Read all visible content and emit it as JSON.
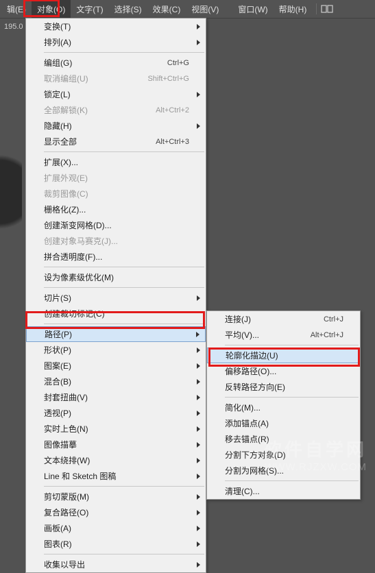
{
  "menubar": {
    "items": [
      {
        "label": "辑(E)"
      },
      {
        "label": "对象(O)"
      },
      {
        "label": "文字(T)"
      },
      {
        "label": "选择(S)"
      },
      {
        "label": "效果(C)"
      },
      {
        "label": "视图(V)"
      },
      {
        "label": "窗口(W)"
      },
      {
        "label": "帮助(H)"
      }
    ]
  },
  "toolbar": {
    "value": "195.0"
  },
  "main_menu": {
    "items": [
      {
        "label": "变换(T)",
        "arrow": true
      },
      {
        "label": "排列(A)",
        "arrow": true
      },
      {
        "sep": true
      },
      {
        "label": "编组(G)",
        "shortcut": "Ctrl+G"
      },
      {
        "label": "取消编组(U)",
        "shortcut": "Shift+Ctrl+G",
        "disabled": true
      },
      {
        "label": "锁定(L)",
        "arrow": true
      },
      {
        "label": "全部解锁(K)",
        "shortcut": "Alt+Ctrl+2",
        "disabled": true
      },
      {
        "label": "隐藏(H)",
        "arrow": true
      },
      {
        "label": "显示全部",
        "shortcut": "Alt+Ctrl+3"
      },
      {
        "sep": true
      },
      {
        "label": "扩展(X)..."
      },
      {
        "label": "扩展外观(E)",
        "disabled": true
      },
      {
        "label": "裁剪图像(C)",
        "disabled": true
      },
      {
        "label": "栅格化(Z)..."
      },
      {
        "label": "创建渐变网格(D)..."
      },
      {
        "label": "创建对象马赛克(J)...",
        "disabled": true
      },
      {
        "label": "拼合透明度(F)..."
      },
      {
        "sep": true
      },
      {
        "label": "设为像素级优化(M)"
      },
      {
        "sep": true
      },
      {
        "label": "切片(S)",
        "arrow": true
      },
      {
        "label": "创建裁切标记(C)"
      },
      {
        "sep": true
      },
      {
        "label": "路径(P)",
        "arrow": true,
        "highlighted": true
      },
      {
        "label": "形状(P)",
        "arrow": true
      },
      {
        "label": "图案(E)",
        "arrow": true
      },
      {
        "label": "混合(B)",
        "arrow": true
      },
      {
        "label": "封套扭曲(V)",
        "arrow": true
      },
      {
        "label": "透视(P)",
        "arrow": true
      },
      {
        "label": "实时上色(N)",
        "arrow": true
      },
      {
        "label": "图像描摹",
        "arrow": true
      },
      {
        "label": "文本绕排(W)",
        "arrow": true
      },
      {
        "label": "Line 和 Sketch 图稿",
        "arrow": true
      },
      {
        "sep": true
      },
      {
        "label": "剪切蒙版(M)",
        "arrow": true
      },
      {
        "label": "复合路径(O)",
        "arrow": true
      },
      {
        "label": "画板(A)",
        "arrow": true
      },
      {
        "label": "图表(R)",
        "arrow": true
      },
      {
        "sep": true
      },
      {
        "label": "收集以导出",
        "arrow": true
      }
    ]
  },
  "sub_menu": {
    "items": [
      {
        "label": "连接(J)",
        "shortcut": "Ctrl+J"
      },
      {
        "label": "平均(V)...",
        "shortcut": "Alt+Ctrl+J"
      },
      {
        "sep": true
      },
      {
        "label": "轮廓化描边(U)",
        "highlighted": true
      },
      {
        "label": "偏移路径(O)..."
      },
      {
        "label": "反转路径方向(E)"
      },
      {
        "sep": true
      },
      {
        "label": "简化(M)..."
      },
      {
        "label": "添加锚点(A)"
      },
      {
        "label": "移去锚点(R)"
      },
      {
        "label": "分割下方对象(D)"
      },
      {
        "label": "分割为网格(S)..."
      },
      {
        "sep": true
      },
      {
        "label": "清理(C)..."
      }
    ]
  },
  "watermark": {
    "cn": "软件自学网",
    "url": "WWW.RJZXW.COM"
  }
}
